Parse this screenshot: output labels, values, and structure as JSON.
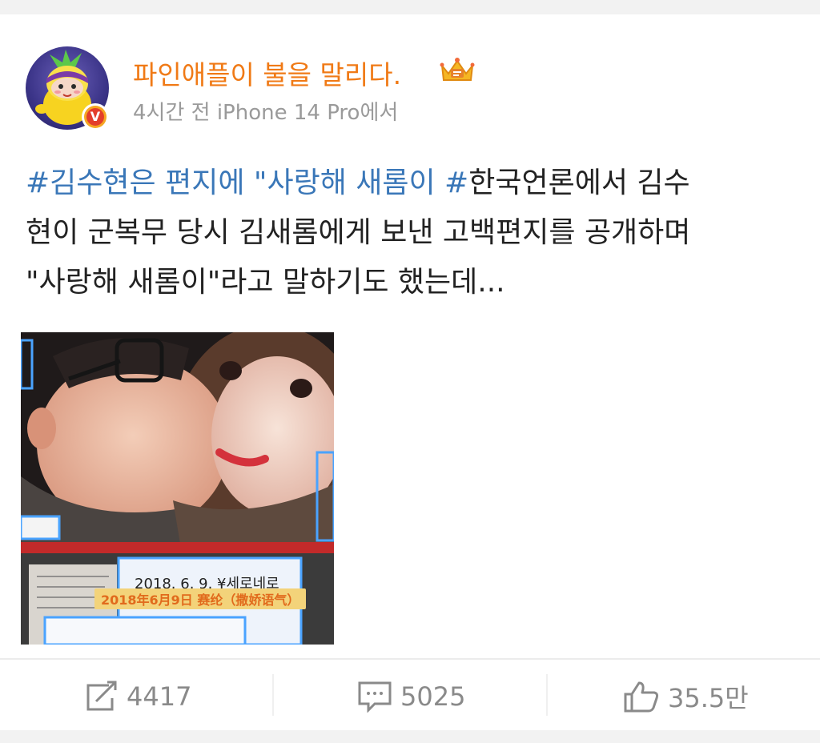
{
  "post": {
    "username": "파인애플이 불을 말리다.",
    "meta": "4시간 전 iPhone 14 Pro에서",
    "lines": [
      [
        {
          "text": "#김수현은 편지에 \"사랑해 새롬이 #",
          "tag": true
        },
        {
          "text": "한국언론에서 김수",
          "tag": false
        }
      ],
      [
        {
          "text": "현이 군복무 당시 김새롬에게 보낸 고백편지를 공개하며",
          "tag": false
        }
      ],
      [
        {
          "text": "\"사랑해 새롬이\"라고 말하기도 했는데...",
          "tag": false
        }
      ]
    ],
    "image_caption": "2018年6月9日 赛纶（撒娇语气）",
    "image_handwriting": "2018. 6. 9.  ¥세로네로",
    "verified_badge": "V",
    "avatar_icon": "pineapple-character-icon",
    "crown_icon": "crown-level-icon"
  },
  "actions": {
    "repost_count": "4417",
    "comment_count": "5025",
    "like_count": "35.5만"
  },
  "colors": {
    "username": "#f07a16",
    "hashtag": "#3a77b8",
    "text": "#222222",
    "meta": "#9a9a9a",
    "action": "#8a8a8a"
  }
}
